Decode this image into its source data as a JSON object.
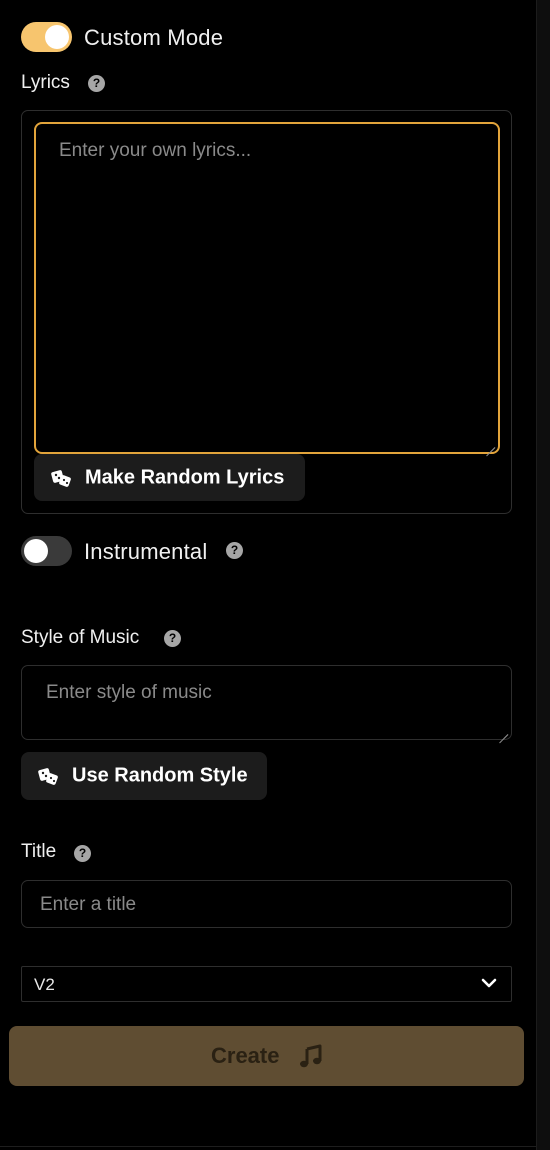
{
  "custom_mode": {
    "label": "Custom Mode",
    "enabled": true
  },
  "lyrics": {
    "label": "Lyrics",
    "help_glyph": "?",
    "placeholder": "Enter your own lyrics...",
    "random_button_label": "Make Random Lyrics",
    "random_icon": "dice-icon"
  },
  "instrumental": {
    "label": "Instrumental",
    "enabled": false,
    "help_glyph": "?"
  },
  "style": {
    "label": "Style of Music",
    "help_glyph": "?",
    "placeholder": "Enter style of music",
    "random_button_label": "Use Random Style",
    "random_icon": "dice-icon"
  },
  "title": {
    "label": "Title",
    "help_glyph": "?",
    "placeholder": "Enter a title"
  },
  "model_select": {
    "value": "V2",
    "icon": "chevron-down-icon"
  },
  "create_button": {
    "label": "Create",
    "icon": "music-note-icon"
  },
  "colors": {
    "accent": "#f7c56e",
    "focus_border": "#e2a43b",
    "create_bg": "#5f4d32",
    "background": "#000000"
  }
}
